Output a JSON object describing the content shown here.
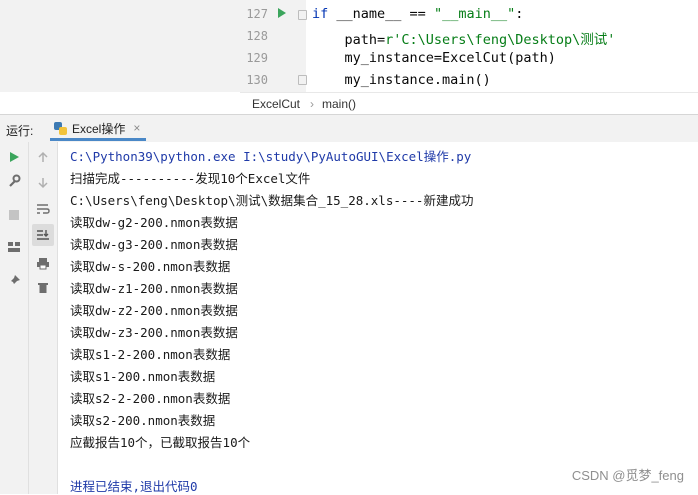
{
  "editor": {
    "lines": [
      {
        "number": "127",
        "parts": [
          {
            "t": "if",
            "c": "kw"
          },
          {
            "t": " __name__ == ",
            "c": ""
          },
          {
            "t": "\"__main__\"",
            "c": "str"
          },
          {
            "t": ":",
            "c": ""
          }
        ]
      },
      {
        "number": "128",
        "parts": [
          {
            "t": "    path=",
            "c": ""
          },
          {
            "t": "r'C:\\Users\\feng\\Desktop\\测试'",
            "c": "str"
          }
        ]
      },
      {
        "number": "129",
        "parts": [
          {
            "t": "    my_instance=ExcelCut(path)",
            "c": ""
          }
        ]
      },
      {
        "number": "130",
        "parts": [
          {
            "t": "    my_instance.main()",
            "c": ""
          }
        ]
      }
    ],
    "breadcrumb": [
      "ExcelCut",
      "main()"
    ]
  },
  "run_panel": {
    "label": "运行:",
    "tab": "Excel操作",
    "tab_close": "×"
  },
  "console": {
    "lines": [
      {
        "text": "C:\\Python39\\python.exe I:\\study\\PyAutoGUI\\Excel操作.py",
        "style": "blue"
      },
      {
        "text": "扫描完成----------发现10个Excel文件",
        "style": ""
      },
      {
        "text": "C:\\Users\\feng\\Desktop\\测试\\数据集合_15_28.xls----新建成功",
        "style": ""
      },
      {
        "text": "读取dw-g2-200.nmon表数据",
        "style": ""
      },
      {
        "text": "读取dw-g3-200.nmon表数据",
        "style": ""
      },
      {
        "text": "读取dw-s-200.nmon表数据",
        "style": ""
      },
      {
        "text": "读取dw-z1-200.nmon表数据",
        "style": ""
      },
      {
        "text": "读取dw-z2-200.nmon表数据",
        "style": ""
      },
      {
        "text": "读取dw-z3-200.nmon表数据",
        "style": ""
      },
      {
        "text": "读取s1-2-200.nmon表数据",
        "style": ""
      },
      {
        "text": "读取s1-200.nmon表数据",
        "style": ""
      },
      {
        "text": "读取s2-2-200.nmon表数据",
        "style": ""
      },
      {
        "text": "读取s2-200.nmon表数据",
        "style": ""
      },
      {
        "text": "应截报告10个，已截取报告10个",
        "style": ""
      },
      {
        "text": "",
        "style": ""
      },
      {
        "text": "进程已结束,退出代码0",
        "style": "blue"
      }
    ]
  },
  "watermark": "CSDN @觅梦_feng",
  "colors": {
    "keyword": "#0033b3",
    "string": "#067d17",
    "blue_text": "#1f3aa8",
    "run_green": "#3ba55c"
  },
  "icons": {
    "left_strip": [
      "run-icon",
      "wrench-icon",
      "stop-icon",
      "layout-icon",
      "pin-icon"
    ],
    "right_strip": [
      "up-arrow-icon",
      "down-arrow-icon",
      "soft-wrap-icon",
      "scroll-to-end-icon",
      "print-icon",
      "trash-icon"
    ]
  }
}
